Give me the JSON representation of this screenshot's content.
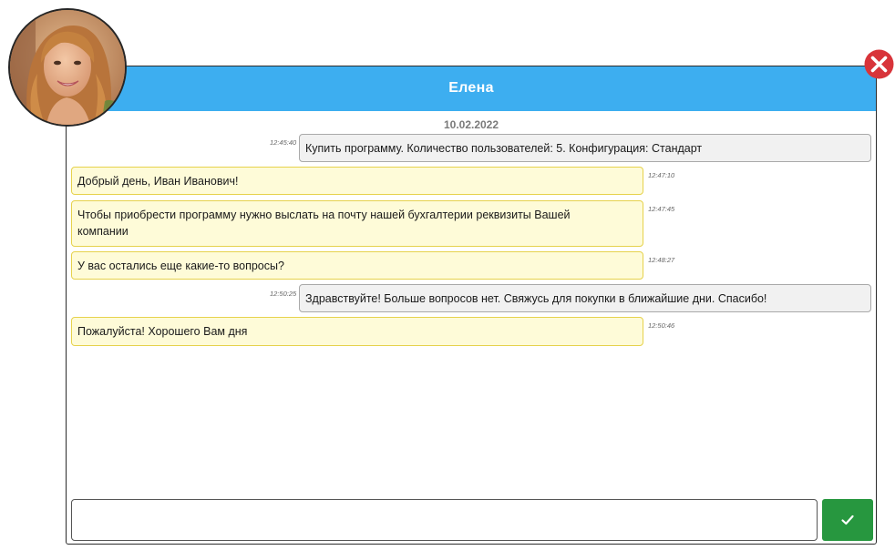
{
  "chat": {
    "contact_name": "Елена",
    "date": "10.02.2022"
  },
  "messages": [
    {
      "direction": "out",
      "time": "12:45:40",
      "text": "Купить программу. Количество пользователей: 5. Конфигурация: Стандарт"
    },
    {
      "direction": "in",
      "time": "12:47:10",
      "text": "Добрый день, Иван Иванович!"
    },
    {
      "direction": "in",
      "time": "12:47:45",
      "text": "Чтобы приобрести программу нужно выслать на почту нашей бухгалтерии реквизиты Вашей компании"
    },
    {
      "direction": "in",
      "time": "12:48:27",
      "text": "У вас остались еще какие-то вопросы?"
    },
    {
      "direction": "out",
      "time": "12:50:25",
      "text": "Здравствуйте! Больше вопросов нет. Свяжусь для покупки в ближайшие дни. Спасибо!"
    },
    {
      "direction": "in",
      "time": "12:50:46",
      "text": "Пожалуйста! Хорошего Вам дня"
    }
  ],
  "input": {
    "value": "",
    "placeholder": ""
  },
  "icons": {
    "close": "close-icon",
    "send": "checkmark-icon",
    "avatar": "contact-photo"
  },
  "colors": {
    "header": "#3daef0",
    "incoming_bubble": "#fefbd8",
    "incoming_border": "#e6d24c",
    "outgoing_bubble": "#f1f1f1",
    "outgoing_border": "#a9a9a9",
    "send_button": "#27973f",
    "close_button": "#d8343a"
  }
}
